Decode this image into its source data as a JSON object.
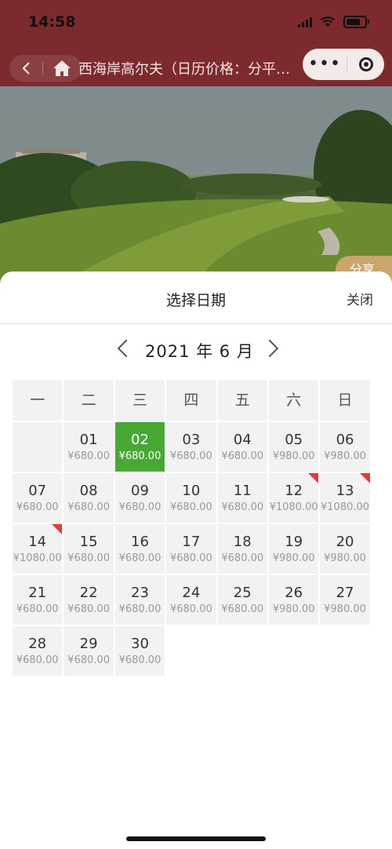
{
  "status_bar": {
    "time": "14:58"
  },
  "nav": {
    "title": "西海岸高尔夫（日历价格：分平…",
    "back_icon": "chevron-left-icon",
    "home_icon": "home-icon",
    "capsule_more": "•••",
    "capsule_close_icon": "mini-program-close-icon"
  },
  "share_label": "分享",
  "sheet": {
    "title": "选择日期",
    "close_label": "关闭",
    "month_label": "2021 年 6 月",
    "weekdays": [
      "一",
      "二",
      "三",
      "四",
      "五",
      "六",
      "日"
    ],
    "weeks": [
      [
        null,
        {
          "day": "01",
          "price": "¥680.00"
        },
        {
          "day": "02",
          "price": "¥680.00",
          "selected": true
        },
        {
          "day": "03",
          "price": "¥680.00"
        },
        {
          "day": "04",
          "price": "¥680.00"
        },
        {
          "day": "05",
          "price": "¥980.00"
        },
        {
          "day": "06",
          "price": "¥980.00"
        }
      ],
      [
        {
          "day": "07",
          "price": "¥680.00"
        },
        {
          "day": "08",
          "price": "¥680.00"
        },
        {
          "day": "09",
          "price": "¥680.00"
        },
        {
          "day": "10",
          "price": "¥680.00"
        },
        {
          "day": "11",
          "price": "¥680.00"
        },
        {
          "day": "12",
          "price": "¥1080.00",
          "flag": true
        },
        {
          "day": "13",
          "price": "¥1080.00",
          "flag": true
        }
      ],
      [
        {
          "day": "14",
          "price": "¥1080.00",
          "flag": true
        },
        {
          "day": "15",
          "price": "¥680.00"
        },
        {
          "day": "16",
          "price": "¥680.00"
        },
        {
          "day": "17",
          "price": "¥680.00"
        },
        {
          "day": "18",
          "price": "¥680.00"
        },
        {
          "day": "19",
          "price": "¥980.00"
        },
        {
          "day": "20",
          "price": "¥980.00"
        }
      ],
      [
        {
          "day": "21",
          "price": "¥680.00"
        },
        {
          "day": "22",
          "price": "¥680.00"
        },
        {
          "day": "23",
          "price": "¥680.00"
        },
        {
          "day": "24",
          "price": "¥680.00"
        },
        {
          "day": "25",
          "price": "¥680.00"
        },
        {
          "day": "26",
          "price": "¥980.00"
        },
        {
          "day": "27",
          "price": "¥980.00"
        }
      ],
      [
        {
          "day": "28",
          "price": "¥680.00"
        },
        {
          "day": "29",
          "price": "¥680.00"
        },
        {
          "day": "30",
          "price": "¥680.00"
        }
      ]
    ]
  },
  "colors": {
    "nav_bg": "#7d2a2e",
    "selected_bg": "#47a834",
    "flag": "#e43b35"
  }
}
